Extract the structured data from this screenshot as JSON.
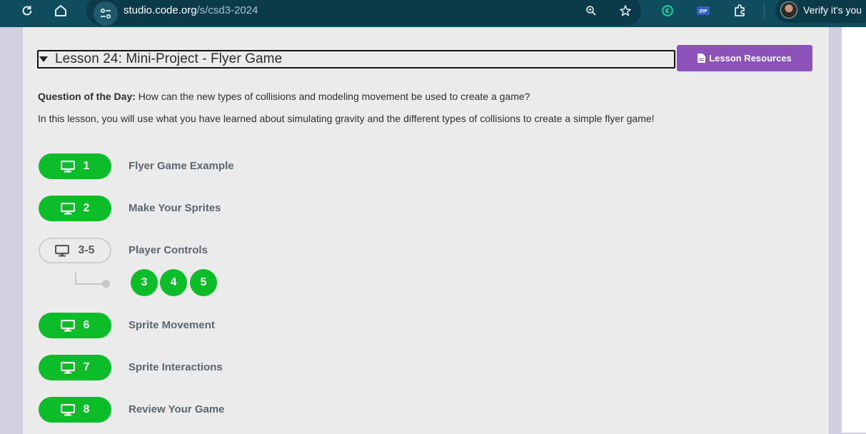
{
  "browser": {
    "url_host": "studio.code.org",
    "url_path": "/s/csd3-2024",
    "profile_label": "Verify it's you"
  },
  "lesson": {
    "title": "Lesson 24: Mini-Project - Flyer Game",
    "resources_button": "Lesson Resources",
    "qotd_label": "Question of the Day:",
    "qotd_text": "How can the new types of collisions and modeling movement be used to create a game?",
    "description": "In this lesson, you will use what you have learned about simulating gravity and the different types of collisions to create a simple flyer game!"
  },
  "levels": [
    {
      "number": "1",
      "label": "Flyer Game Example"
    },
    {
      "number": "2",
      "label": "Make Your Sprites"
    },
    {
      "number": "3-5",
      "label": "Player Controls",
      "sublevels": [
        "3",
        "4",
        "5"
      ]
    },
    {
      "number": "6",
      "label": "Sprite Movement"
    },
    {
      "number": "7",
      "label": "Sprite Interactions"
    },
    {
      "number": "8",
      "label": "Review Your Game"
    }
  ],
  "colors": {
    "accent_green": "#0cbd29",
    "resources_purple": "#8c52ba",
    "toolbar": "#0e4c5e"
  }
}
